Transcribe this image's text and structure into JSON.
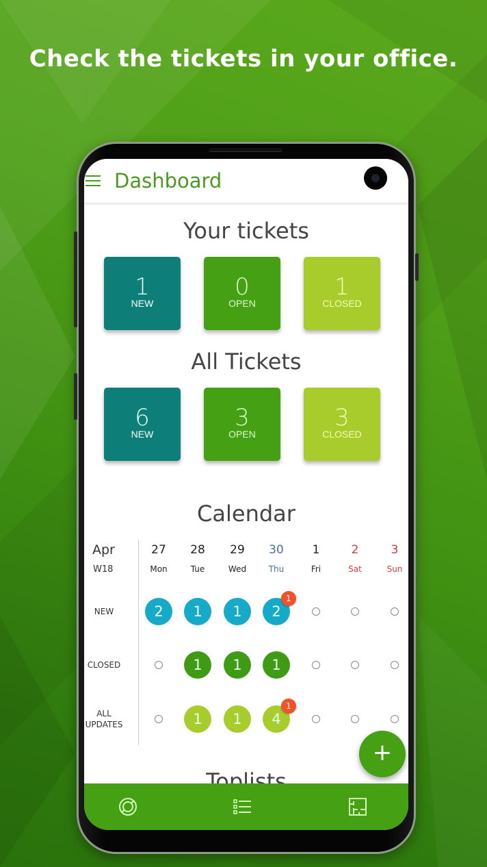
{
  "headline": "Check the tickets in your office.",
  "appbar": {
    "title": "Dashboard",
    "menu_icon": "hamburger-menu-icon"
  },
  "your_tickets": {
    "title": "Your tickets",
    "tiles": [
      {
        "count": "1",
        "label": "NEW"
      },
      {
        "count": "0",
        "label": "OPEN"
      },
      {
        "count": "1",
        "label": "CLOSED"
      }
    ]
  },
  "all_tickets": {
    "title": "All Tickets",
    "tiles": [
      {
        "count": "6",
        "label": "NEW"
      },
      {
        "count": "3",
        "label": "OPEN"
      },
      {
        "count": "3",
        "label": "CLOSED"
      }
    ]
  },
  "calendar": {
    "title": "Calendar",
    "month": "Apr",
    "week": "W18",
    "days": [
      {
        "num": "27",
        "name": "Mon",
        "type": "normal"
      },
      {
        "num": "28",
        "name": "Tue",
        "type": "normal"
      },
      {
        "num": "29",
        "name": "Wed",
        "type": "normal"
      },
      {
        "num": "30",
        "name": "Thu",
        "type": "today"
      },
      {
        "num": "1",
        "name": "Fri",
        "type": "normal"
      },
      {
        "num": "2",
        "name": "Sat",
        "type": "weekend"
      },
      {
        "num": "3",
        "name": "Sun",
        "type": "weekend"
      }
    ],
    "rows": [
      {
        "label": "NEW",
        "kind": "new",
        "values": [
          "2",
          "1",
          "1",
          "2",
          "",
          "",
          ""
        ],
        "badges": [
          "",
          "",
          "",
          "1",
          "",
          "",
          ""
        ]
      },
      {
        "label": "CLOSED",
        "kind": "closed",
        "values": [
          "",
          "1",
          "1",
          "1",
          "",
          "",
          ""
        ],
        "badges": [
          "",
          "",
          "",
          "",
          "",
          "",
          ""
        ]
      },
      {
        "label": "ALL UPDATES",
        "kind": "updates",
        "values": [
          "",
          "1",
          "1",
          "4",
          "",
          "",
          ""
        ],
        "badges": [
          "",
          "",
          "",
          "1",
          "",
          "",
          ""
        ]
      }
    ]
  },
  "fab": {
    "label": "+",
    "icon": "plus-icon"
  },
  "toplists": {
    "title": "Toplists"
  },
  "bottom_nav": [
    {
      "name": "dashboard",
      "icon": "donut-chart-icon"
    },
    {
      "name": "tickets-list",
      "icon": "list-icon"
    },
    {
      "name": "floor-plan",
      "icon": "floor-plan-icon"
    }
  ],
  "colors": {
    "brand_green": "#46a014",
    "title_green": "#4a9a22",
    "new_teal": "#0e7f78",
    "closed_lime": "#a8cc2c",
    "cal_new": "#16aac8",
    "cal_closed": "#3f9a14",
    "cal_updates": "#a8cc2c",
    "badge": "#f0522a",
    "today_blue": "#4a6fa5",
    "weekend_red": "#d33c3c"
  }
}
